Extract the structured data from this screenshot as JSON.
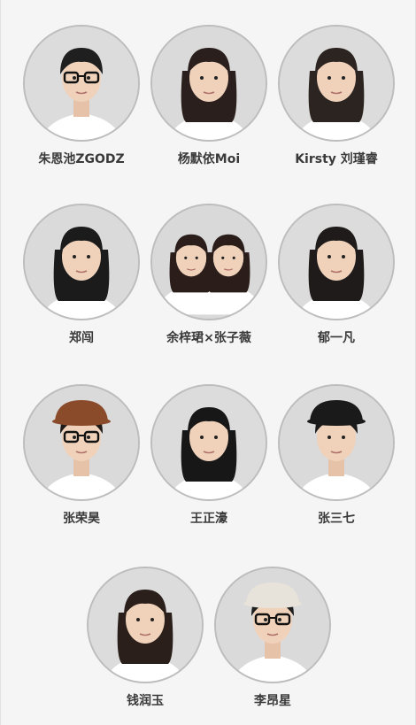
{
  "artists": [
    {
      "name": "朱恩池ZGODZ",
      "hair": "#1f1f1f",
      "shirt": "#ffffff",
      "bg": "#dcdcdc",
      "glasses": true,
      "hat": null
    },
    {
      "name": "杨默依Moi",
      "hair": "#2a1f1c",
      "shirt": "#ffffff",
      "bg": "#dadada",
      "glasses": false,
      "hat": null
    },
    {
      "name": "Kirsty 刘瑾睿",
      "hair": "#2b2420",
      "shirt": "#ffffff",
      "bg": "#dcdcdc",
      "glasses": false,
      "hat": null
    },
    {
      "name": "郑闯",
      "hair": "#1b1b1b",
      "shirt": "#ffffff",
      "bg": "#dadada",
      "glasses": false,
      "hat": null
    },
    {
      "name": "余梓珺×张子薇",
      "hair": "#2a1d1a",
      "shirt": "#ffffff",
      "bg": "#d9d9d9",
      "glasses": false,
      "hat": null,
      "duo": true
    },
    {
      "name": "郁一凡",
      "hair": "#1e1b1a",
      "shirt": "#ffffff",
      "bg": "#dcdcdc",
      "glasses": false,
      "hat": null
    },
    {
      "name": "张荣昊",
      "hair": "#1f1a17",
      "shirt": "#ffffff",
      "bg": "#dadada",
      "glasses": true,
      "hat": "#8a4b2a"
    },
    {
      "name": "王正濠",
      "hair": "#171717",
      "shirt": "#ffffff",
      "bg": "#dcdcdc",
      "glasses": false,
      "hat": null
    },
    {
      "name": "张三七",
      "hair": "#1a1a1a",
      "shirt": "#ffffff",
      "bg": "#dadada",
      "glasses": false,
      "hat": "#1a1a1a"
    },
    {
      "name": "钱润玉",
      "hair": "#2b1f1b",
      "shirt": "#ffffff",
      "bg": "#dcdcdc",
      "glasses": false,
      "hat": null
    },
    {
      "name": "李昂星",
      "hair": "#1e1e1e",
      "shirt": "#ffffff",
      "bg": "#dadada",
      "glasses": true,
      "hat": "#e8e3da"
    }
  ]
}
